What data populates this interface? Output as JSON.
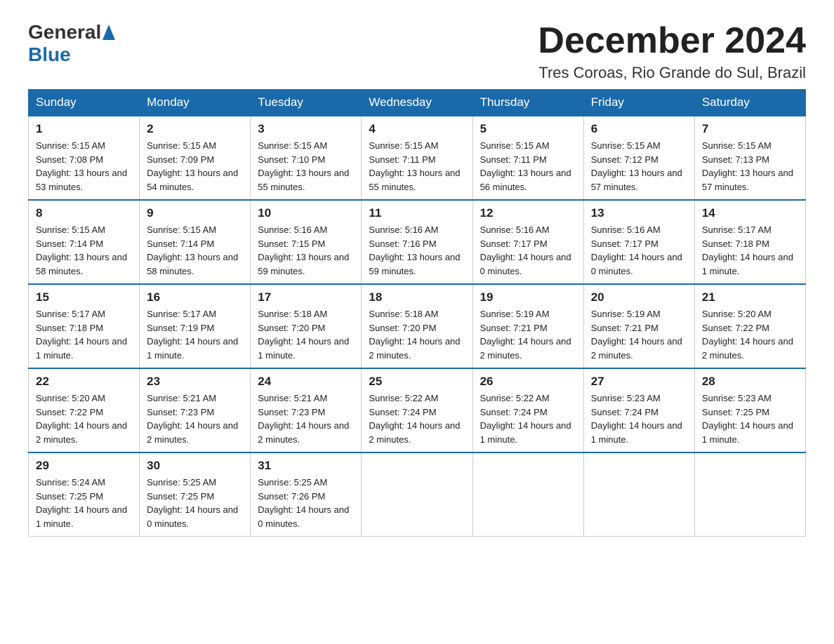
{
  "header": {
    "logo_general": "General",
    "logo_blue": "Blue",
    "title": "December 2024",
    "subtitle": "Tres Coroas, Rio Grande do Sul, Brazil"
  },
  "days_of_week": [
    "Sunday",
    "Monday",
    "Tuesday",
    "Wednesday",
    "Thursday",
    "Friday",
    "Saturday"
  ],
  "weeks": [
    [
      {
        "day": "1",
        "sunrise": "5:15 AM",
        "sunset": "7:08 PM",
        "daylight": "13 hours and 53 minutes."
      },
      {
        "day": "2",
        "sunrise": "5:15 AM",
        "sunset": "7:09 PM",
        "daylight": "13 hours and 54 minutes."
      },
      {
        "day": "3",
        "sunrise": "5:15 AM",
        "sunset": "7:10 PM",
        "daylight": "13 hours and 55 minutes."
      },
      {
        "day": "4",
        "sunrise": "5:15 AM",
        "sunset": "7:11 PM",
        "daylight": "13 hours and 55 minutes."
      },
      {
        "day": "5",
        "sunrise": "5:15 AM",
        "sunset": "7:11 PM",
        "daylight": "13 hours and 56 minutes."
      },
      {
        "day": "6",
        "sunrise": "5:15 AM",
        "sunset": "7:12 PM",
        "daylight": "13 hours and 57 minutes."
      },
      {
        "day": "7",
        "sunrise": "5:15 AM",
        "sunset": "7:13 PM",
        "daylight": "13 hours and 57 minutes."
      }
    ],
    [
      {
        "day": "8",
        "sunrise": "5:15 AM",
        "sunset": "7:14 PM",
        "daylight": "13 hours and 58 minutes."
      },
      {
        "day": "9",
        "sunrise": "5:15 AM",
        "sunset": "7:14 PM",
        "daylight": "13 hours and 58 minutes."
      },
      {
        "day": "10",
        "sunrise": "5:16 AM",
        "sunset": "7:15 PM",
        "daylight": "13 hours and 59 minutes."
      },
      {
        "day": "11",
        "sunrise": "5:16 AM",
        "sunset": "7:16 PM",
        "daylight": "13 hours and 59 minutes."
      },
      {
        "day": "12",
        "sunrise": "5:16 AM",
        "sunset": "7:17 PM",
        "daylight": "14 hours and 0 minutes."
      },
      {
        "day": "13",
        "sunrise": "5:16 AM",
        "sunset": "7:17 PM",
        "daylight": "14 hours and 0 minutes."
      },
      {
        "day": "14",
        "sunrise": "5:17 AM",
        "sunset": "7:18 PM",
        "daylight": "14 hours and 1 minute."
      }
    ],
    [
      {
        "day": "15",
        "sunrise": "5:17 AM",
        "sunset": "7:18 PM",
        "daylight": "14 hours and 1 minute."
      },
      {
        "day": "16",
        "sunrise": "5:17 AM",
        "sunset": "7:19 PM",
        "daylight": "14 hours and 1 minute."
      },
      {
        "day": "17",
        "sunrise": "5:18 AM",
        "sunset": "7:20 PM",
        "daylight": "14 hours and 1 minute."
      },
      {
        "day": "18",
        "sunrise": "5:18 AM",
        "sunset": "7:20 PM",
        "daylight": "14 hours and 2 minutes."
      },
      {
        "day": "19",
        "sunrise": "5:19 AM",
        "sunset": "7:21 PM",
        "daylight": "14 hours and 2 minutes."
      },
      {
        "day": "20",
        "sunrise": "5:19 AM",
        "sunset": "7:21 PM",
        "daylight": "14 hours and 2 minutes."
      },
      {
        "day": "21",
        "sunrise": "5:20 AM",
        "sunset": "7:22 PM",
        "daylight": "14 hours and 2 minutes."
      }
    ],
    [
      {
        "day": "22",
        "sunrise": "5:20 AM",
        "sunset": "7:22 PM",
        "daylight": "14 hours and 2 minutes."
      },
      {
        "day": "23",
        "sunrise": "5:21 AM",
        "sunset": "7:23 PM",
        "daylight": "14 hours and 2 minutes."
      },
      {
        "day": "24",
        "sunrise": "5:21 AM",
        "sunset": "7:23 PM",
        "daylight": "14 hours and 2 minutes."
      },
      {
        "day": "25",
        "sunrise": "5:22 AM",
        "sunset": "7:24 PM",
        "daylight": "14 hours and 2 minutes."
      },
      {
        "day": "26",
        "sunrise": "5:22 AM",
        "sunset": "7:24 PM",
        "daylight": "14 hours and 1 minute."
      },
      {
        "day": "27",
        "sunrise": "5:23 AM",
        "sunset": "7:24 PM",
        "daylight": "14 hours and 1 minute."
      },
      {
        "day": "28",
        "sunrise": "5:23 AM",
        "sunset": "7:25 PM",
        "daylight": "14 hours and 1 minute."
      }
    ],
    [
      {
        "day": "29",
        "sunrise": "5:24 AM",
        "sunset": "7:25 PM",
        "daylight": "14 hours and 1 minute."
      },
      {
        "day": "30",
        "sunrise": "5:25 AM",
        "sunset": "7:25 PM",
        "daylight": "14 hours and 0 minutes."
      },
      {
        "day": "31",
        "sunrise": "5:25 AM",
        "sunset": "7:26 PM",
        "daylight": "14 hours and 0 minutes."
      },
      null,
      null,
      null,
      null
    ]
  ]
}
